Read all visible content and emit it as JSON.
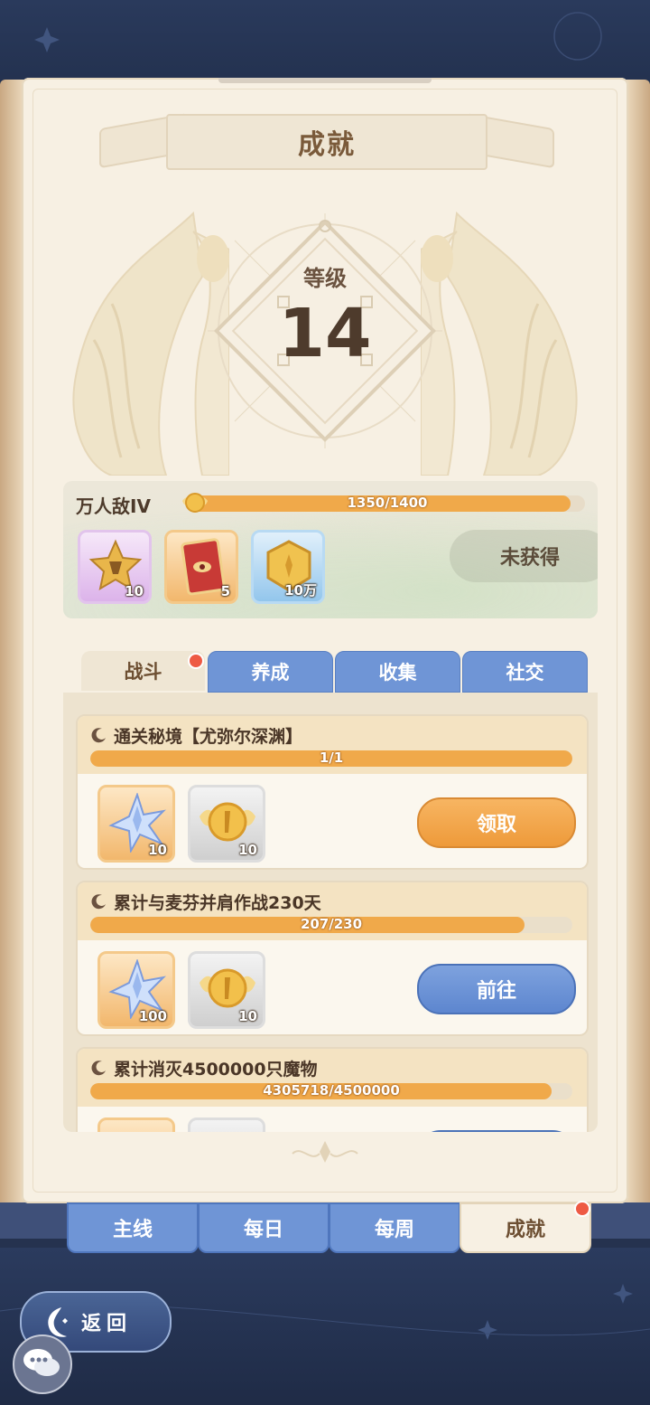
{
  "header": {
    "title": "成就"
  },
  "level": {
    "label": "等级",
    "value": "14"
  },
  "tier": {
    "name": "万人敌IV",
    "progress_text": "1350/1400",
    "progress": 0.964,
    "rewards": [
      {
        "icon": "star-badge-icon",
        "qty": "10",
        "color": "purple"
      },
      {
        "icon": "eye-card-icon",
        "qty": "5",
        "color": "orange"
      },
      {
        "icon": "gold-coin-icon",
        "qty": "10万",
        "color": "blue"
      }
    ],
    "status_button": "未获得"
  },
  "category_tabs": [
    {
      "label": "战斗",
      "active": true,
      "badge": true
    },
    {
      "label": "养成",
      "active": false
    },
    {
      "label": "收集",
      "active": false
    },
    {
      "label": "社交",
      "active": false
    }
  ],
  "tasks": [
    {
      "title": "通关秘境【尤弥尔深渊】",
      "progress_text": "1/1",
      "progress": 1.0,
      "rewards": [
        {
          "icon": "crystal-star-icon",
          "qty": "10",
          "color": "orange"
        },
        {
          "icon": "winged-coin-icon",
          "qty": "10",
          "color": "grey"
        }
      ],
      "button": "领取",
      "button_type": "claim"
    },
    {
      "title": "累计与麦芬并肩作战230天",
      "progress_text": "207/230",
      "progress": 0.9,
      "rewards": [
        {
          "icon": "crystal-star-icon",
          "qty": "100",
          "color": "orange"
        },
        {
          "icon": "winged-coin-icon",
          "qty": "10",
          "color": "grey"
        }
      ],
      "button": "前往",
      "button_type": "go"
    },
    {
      "title": "累计消灭4500000只魔物",
      "progress_text": "4305718/4500000",
      "progress": 0.957,
      "rewards": [
        {
          "icon": "crystal-star-icon",
          "qty": "",
          "color": "orange"
        },
        {
          "icon": "winged-coin-icon",
          "qty": "",
          "color": "grey"
        }
      ],
      "button": "",
      "button_type": "go"
    }
  ],
  "bottom_tabs": [
    {
      "label": "主线",
      "active": false
    },
    {
      "label": "每日",
      "active": false
    },
    {
      "label": "每周",
      "active": false
    },
    {
      "label": "成就",
      "active": true,
      "badge": true
    }
  ],
  "back_button": "返回",
  "colors": {
    "accent_orange": "#f0a94a",
    "tab_blue": "#6f95d6",
    "page_bg": "#f7f0e3"
  }
}
